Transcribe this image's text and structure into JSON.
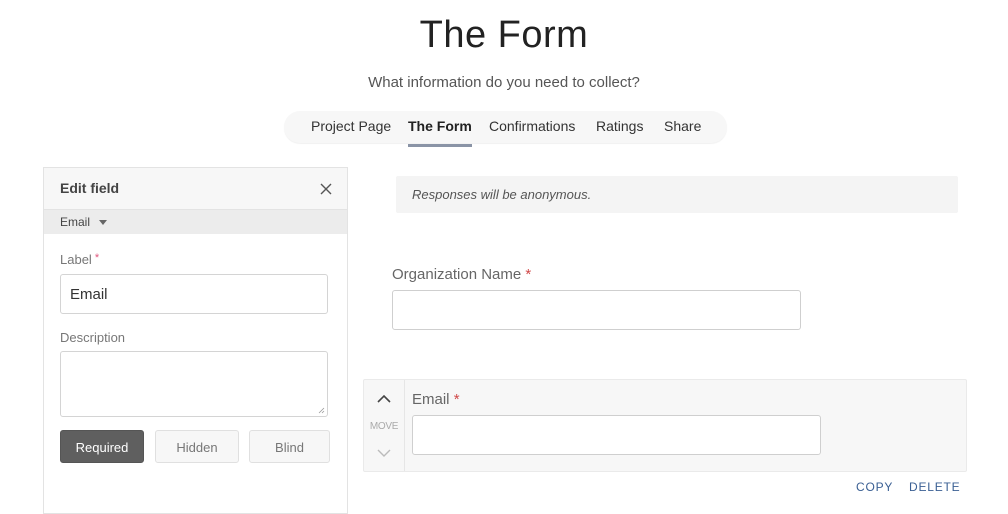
{
  "header": {
    "title": "The Form",
    "subtitle": "What information do you need to collect?"
  },
  "tabs": [
    {
      "label": "Project Page",
      "active": false
    },
    {
      "label": "The Form",
      "active": true
    },
    {
      "label": "Confirmations",
      "active": false
    },
    {
      "label": "Ratings",
      "active": false
    },
    {
      "label": "Share",
      "active": false
    }
  ],
  "edit_panel": {
    "title": "Edit field",
    "close_icon": "close-icon",
    "field_type": "Email",
    "label_caption": "Label",
    "required_marker": "*",
    "label_value": "Email",
    "description_caption": "Description",
    "description_value": "",
    "buttons": {
      "required": "Required",
      "hidden": "Hidden",
      "blind": "Blind"
    },
    "required_active": true
  },
  "form": {
    "notice": "Responses will be anonymous.",
    "fields": [
      {
        "label": "Organization Name",
        "required_marker": "*",
        "value": ""
      },
      {
        "label": "Email",
        "required_marker": "*",
        "value": ""
      }
    ],
    "move_label": "MOVE",
    "actions": {
      "copy": "COPY",
      "delete": "DELETE"
    }
  },
  "colors": {
    "accent_link": "#3a5f93",
    "required_star": "#d04848",
    "active_tab_underline": "#8a94a6",
    "required_button_bg": "#5f5f5f"
  }
}
